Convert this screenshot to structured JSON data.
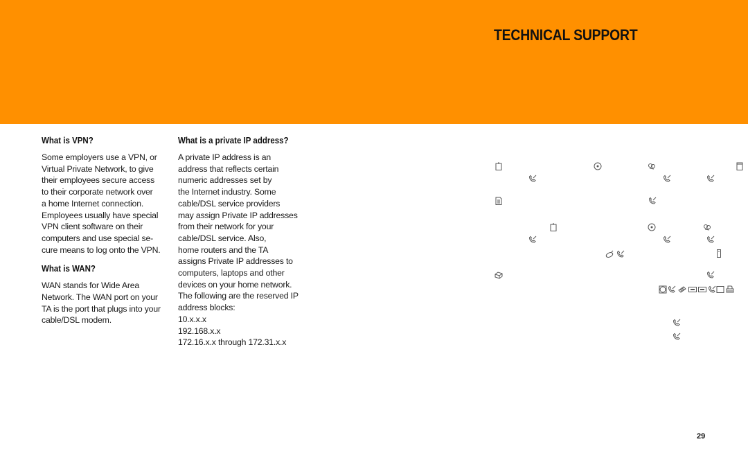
{
  "header": {
    "title": "TECHNICAL SUPPORT",
    "banner_color": "#ff9000"
  },
  "sections": {
    "vpn": {
      "heading": "What is VPN?",
      "body": "Some employers use a VPN, or\nVirtual Private Network, to give\ntheir employees secure access\nto their corporate network over\na home Internet connection.\nEmployees usually have special\nVPN client software on their\ncomputers and use special se-\ncure means to log onto the VPN."
    },
    "wan": {
      "heading": "What is WAN?",
      "body": "WAN stands for Wide Area\nNetwork. The WAN port on your\nTA is the port that plugs into your\ncable/DSL modem."
    },
    "private_ip": {
      "heading": "What is a private IP address?",
      "body": "A private IP address is an\naddress that reflects certain\nnumeric addresses set by\nthe Internet industry. Some\ncable/DSL service providers\nmay assign Private IP addresses\nfrom their network for your\ncable/DSL service. Also,\nhome routers and the TA\nassigns Private IP addresses to\ncomputers, laptops and other\ndevices on your home network.\nThe following are the reserved IP\naddress blocks:\n10.x.x.x\n192.168.x.x\n172.16.x.x through 172.31.x.x"
    }
  },
  "icons": [
    "clipboard-icon",
    "disc-icon",
    "network-icon",
    "device-icon",
    "phone-icon",
    "phone-icon",
    "phone-icon",
    "document-icon",
    "phone-icon",
    "clipboard-icon",
    "disc-icon",
    "network-icon",
    "phone-icon",
    "phone-icon",
    "phone-icon",
    "mouse-icon",
    "phone-icon",
    "tower-icon",
    "drive-icon",
    "phone-icon",
    "monitor-icon",
    "phone-icon",
    "keyboard-icon",
    "slot-icon",
    "slot-icon",
    "phone-icon",
    "screen-icon",
    "printer-icon",
    "phone-icon",
    "phone-icon"
  ],
  "footer": {
    "page_number": "29"
  }
}
